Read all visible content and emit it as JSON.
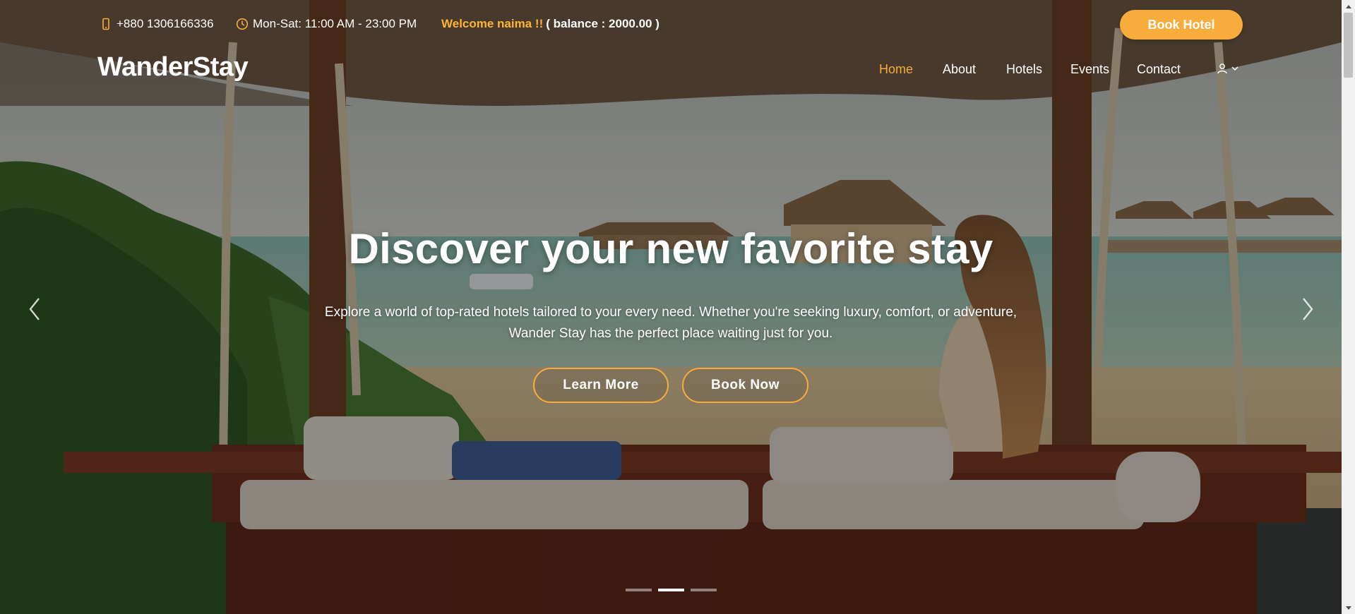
{
  "topbar": {
    "phone": "+880 1306166336",
    "hours": "Mon-Sat: 11:00 AM - 23:00 PM",
    "welcome": "Welcome naima !!",
    "balance": "( balance : 2000.00 )",
    "book_hotel_label": "Book Hotel"
  },
  "brand": {
    "logo": "WanderStay"
  },
  "nav": {
    "items": [
      {
        "label": "Home",
        "active": true
      },
      {
        "label": "About"
      },
      {
        "label": "Hotels"
      },
      {
        "label": "Events"
      },
      {
        "label": "Contact"
      }
    ],
    "user_icon": "user-icon",
    "chevron_icon": "chevron-down-icon"
  },
  "hero": {
    "title": "Discover your new favorite stay",
    "subtitle_line1": "Explore a world of top-rated hotels tailored to your every need. Whether you're seeking luxury, comfort, or adventure,",
    "subtitle_line2": "Wander Stay has the perfect place waiting just for you.",
    "learn_more_label": "Learn More",
    "book_now_label": "Book Now"
  },
  "carousel": {
    "slide_count": 3,
    "active_index": 1,
    "prev_icon": "chevron-left-icon",
    "next_icon": "chevron-right-icon"
  },
  "colors": {
    "accent": "#f8ac3c",
    "welcome": "#ffb534",
    "text": "#ffffff"
  }
}
